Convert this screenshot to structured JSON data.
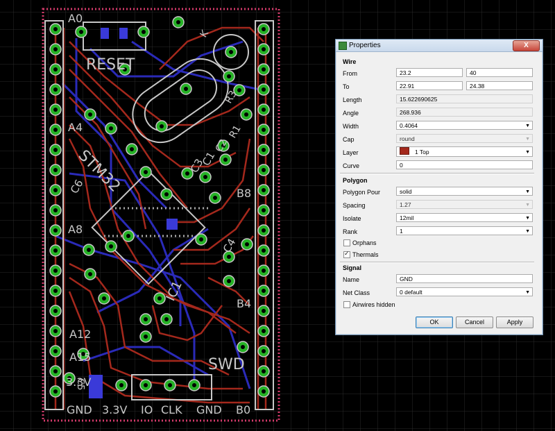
{
  "board": {
    "labels": {
      "a0": "A0",
      "reset": "RESET",
      "a4": "A4",
      "a8": "A8",
      "a12": "A12",
      "a15": "A15",
      "b8": "B8",
      "b4": "B4",
      "swd": "SWD",
      "v33": "3.3V",
      "bottom_gnd1": "GND",
      "bottom_33v": "3.3V",
      "bottom_io": "IO",
      "bottom_clk": "CLK",
      "bottom_gnd2": "GND",
      "bottom_b0": "B0",
      "stm32": "STM32",
      "ic1": "IC1",
      "c1": "C1",
      "c2": "C2",
      "c3": "C3",
      "c4": "C4",
      "c5": "C5",
      "c6": "C6",
      "r1": "R1",
      "r3": "R3",
      "k": "K"
    },
    "colors": {
      "trace_top": "#a4281c",
      "trace_bottom": "#2a2ab8",
      "pad": "#26b226",
      "grid": "#2a2a2a",
      "silk": "#c8c8c8"
    }
  },
  "dialog": {
    "title": "Properties",
    "close_label": "X",
    "wire": {
      "header": "Wire",
      "from_label": "From",
      "from_x": "23.2",
      "from_y": "40",
      "to_label": "To",
      "to_x": "22.91",
      "to_y": "24.38",
      "length_label": "Length",
      "length": "15.622690625",
      "angle_label": "Angle",
      "angle": "268.936",
      "width_label": "Width",
      "width": "0.4064",
      "cap_label": "Cap",
      "cap": "round",
      "layer_label": "Layer",
      "layer": "1 Top",
      "curve_label": "Curve",
      "curve": "0"
    },
    "polygon": {
      "header": "Polygon",
      "pour_label": "Polygon Pour",
      "pour": "solid",
      "spacing_label": "Spacing",
      "spacing": "1.27",
      "isolate_label": "Isolate",
      "isolate": "12mil",
      "rank_label": "Rank",
      "rank": "1",
      "orphans_label": "Orphans",
      "orphans_checked": false,
      "thermals_label": "Thermals",
      "thermals_checked": true
    },
    "signal": {
      "header": "Signal",
      "name_label": "Name",
      "name": "GND",
      "netclass_label": "Net Class",
      "netclass": "0 default",
      "airwires_label": "Airwires hidden",
      "airwires_checked": false
    },
    "buttons": {
      "ok": "OK",
      "cancel": "Cancel",
      "apply": "Apply"
    }
  }
}
